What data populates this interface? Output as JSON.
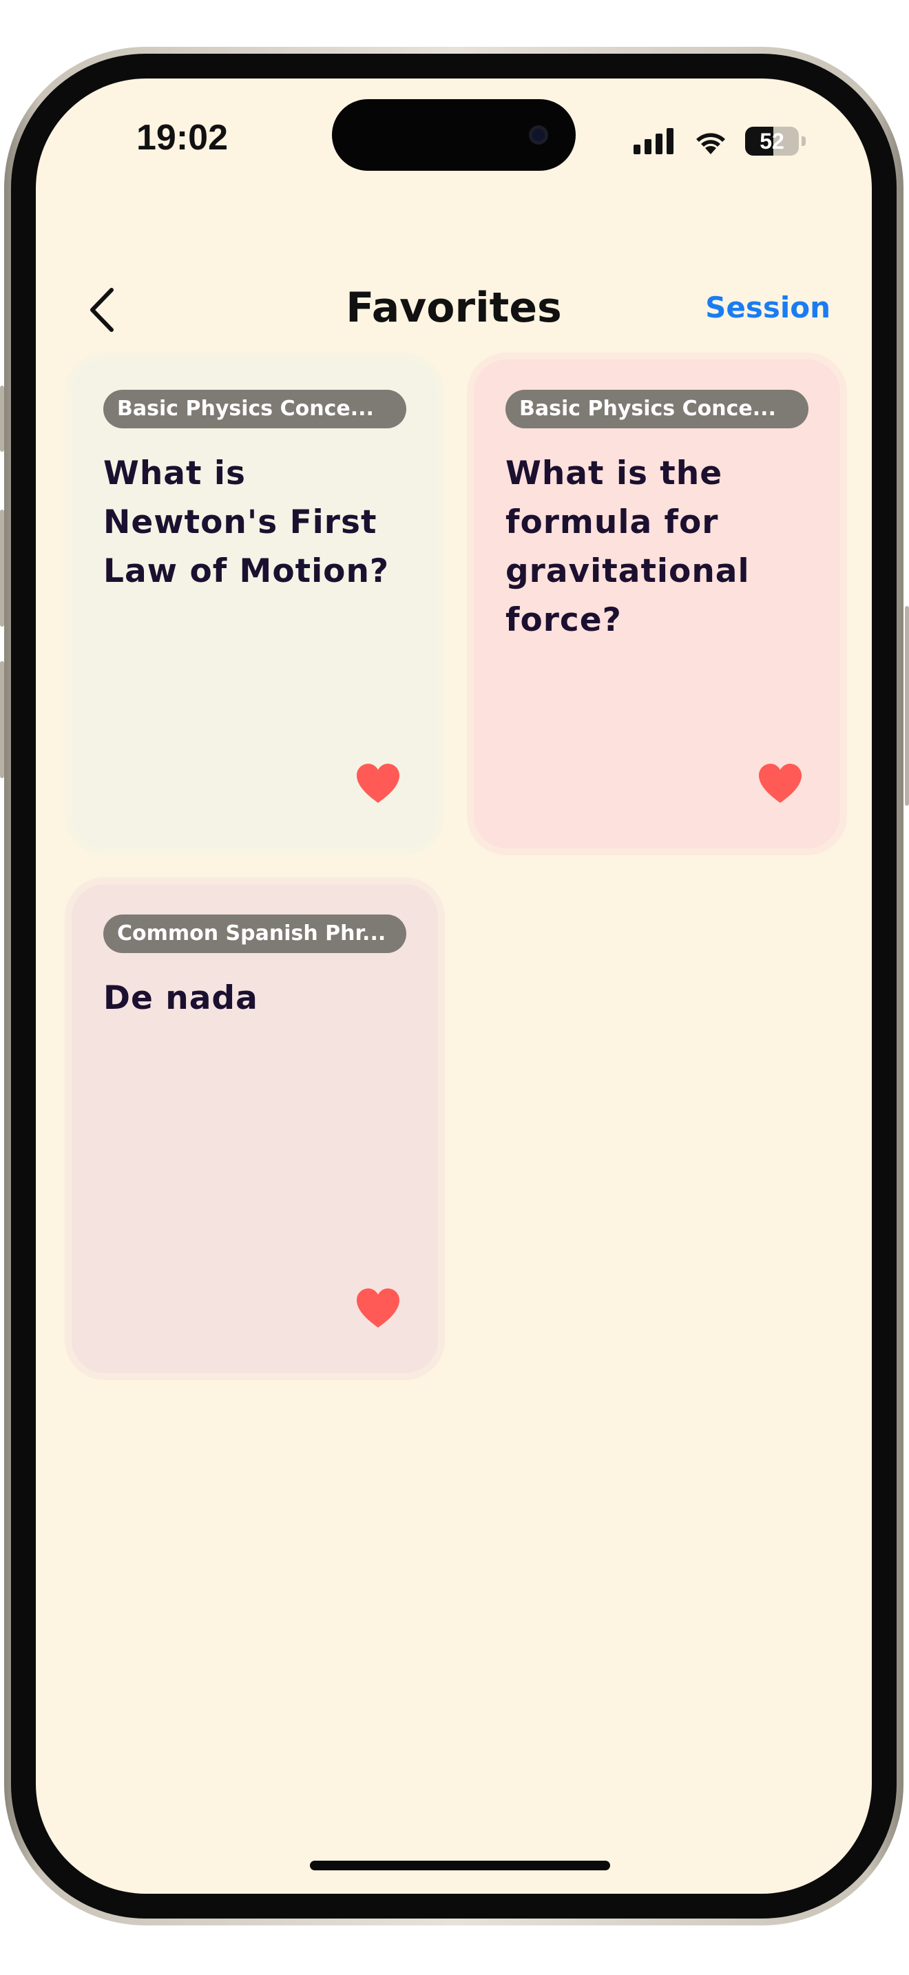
{
  "status_bar": {
    "time": "19:02",
    "battery_level": "52"
  },
  "nav": {
    "back_icon": "chevron-left-icon",
    "title": "Favorites",
    "action_label": "Session"
  },
  "colors": {
    "background": "#fdf4e2",
    "accent": "#1a7cf2",
    "heart": "#ff5a55",
    "tag_bg": "#7e7a74",
    "text": "#1c1030"
  },
  "cards": [
    {
      "tag": "Basic Physics Conce...",
      "question": "What is Newton's First Law of Motion?",
      "favorite_icon": "heart-icon",
      "bg": "#f4f3e6"
    },
    {
      "tag": "Basic Physics Conce...",
      "question": "What is the formula for gravitational force?",
      "favorite_icon": "heart-icon",
      "bg": "#fde1dc"
    },
    {
      "tag": "Common Spanish Phr...",
      "question": "De nada",
      "favorite_icon": "heart-icon",
      "bg": "#f5e3e0"
    }
  ]
}
